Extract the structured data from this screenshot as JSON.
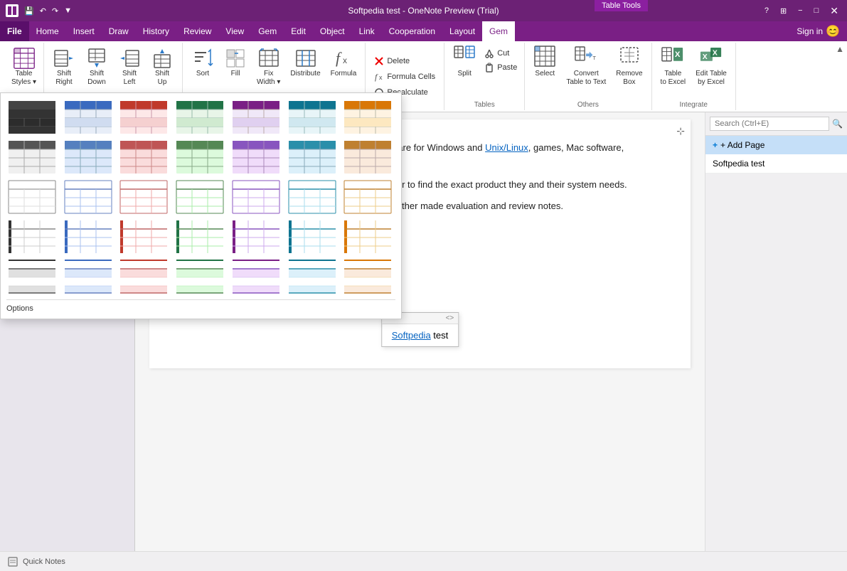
{
  "titleBar": {
    "appTitle": "Softpedia test - OneNote Preview (Trial)",
    "tableToolsLabel": "Table Tools",
    "buttons": [
      "minimize",
      "maximize",
      "close"
    ],
    "quickAccess": [
      "undo",
      "redo",
      "customize"
    ]
  },
  "menuBar": {
    "items": [
      "File",
      "Home",
      "Insert",
      "Draw",
      "History",
      "Review",
      "View",
      "Gem",
      "Edit",
      "Object",
      "Link",
      "Cooperation",
      "Layout",
      "Gem"
    ],
    "activeItem": "Gem",
    "signIn": "Sign in"
  },
  "ribbon": {
    "groups": [
      {
        "id": "table-styles",
        "label": "",
        "buttons": [
          {
            "id": "table-styles-btn",
            "label": "Table\nStyles -",
            "type": "large"
          }
        ]
      },
      {
        "id": "shift",
        "label": "",
        "buttons": [
          {
            "id": "shift-right",
            "label": "Shift\nRight",
            "type": "large"
          },
          {
            "id": "shift-down",
            "label": "Shift\nDown",
            "type": "large"
          },
          {
            "id": "shift-left",
            "label": "Shift\nLeft",
            "type": "large"
          },
          {
            "id": "shift-up",
            "label": "Shift\nUp",
            "type": "large"
          }
        ]
      },
      {
        "id": "sort-fill",
        "label": "",
        "buttons": [
          {
            "id": "sort",
            "label": "Sort",
            "type": "large"
          },
          {
            "id": "fill",
            "label": "Fill",
            "type": "large"
          },
          {
            "id": "fix-width",
            "label": "Fix\nWidth -",
            "type": "large"
          },
          {
            "id": "distribute",
            "label": "Distribute",
            "type": "large"
          },
          {
            "id": "formula",
            "label": "Formula",
            "type": "large"
          }
        ]
      },
      {
        "id": "edit-menu",
        "label": "",
        "buttons": [
          {
            "id": "delete",
            "label": "Delete",
            "type": "small"
          },
          {
            "id": "formula-cells",
            "label": "Formula Cells",
            "type": "small"
          },
          {
            "id": "recalculate",
            "label": "Recalculate",
            "type": "small"
          }
        ]
      },
      {
        "id": "tables",
        "label": "Tables",
        "buttons": [
          {
            "id": "split",
            "label": "Split",
            "type": "large"
          },
          {
            "id": "cut",
            "label": "Cut",
            "type": "small"
          },
          {
            "id": "paste",
            "label": "Paste",
            "type": "small"
          }
        ]
      },
      {
        "id": "others",
        "label": "Others",
        "buttons": [
          {
            "id": "select",
            "label": "Select",
            "type": "large"
          },
          {
            "id": "convert",
            "label": "Convert\nTable to Text",
            "type": "large"
          },
          {
            "id": "remove-box",
            "label": "Remove\nBox",
            "type": "large"
          }
        ]
      },
      {
        "id": "integrate",
        "label": "Integrate",
        "buttons": [
          {
            "id": "table-to-excel",
            "label": "Table\nto Excel",
            "type": "large"
          },
          {
            "id": "edit-table-by-excel",
            "label": "Edit Table\nby Excel",
            "type": "large"
          }
        ]
      }
    ]
  },
  "tableStyles": {
    "rows": 5,
    "cols": 7,
    "colors": [
      "black",
      "blue",
      "red",
      "green",
      "purple",
      "teal",
      "orange"
    ],
    "optionsLabel": "Options"
  },
  "content": {
    "paragraphs": [
      "is a library of over 1,500,000 free and free-to-try software for Windows and Unix/Linux, games, Mac software, Windows mobile devices and IT-related articles.",
      "w and categorize these products in order to allow the er to find the exact product they and their system needs.",
      "to deliver only the best products to the visitor/user together made evaluation and review notes.",
      "oftpedia test"
    ],
    "links": [
      "Unix/Linux",
      "Softpedia"
    ]
  },
  "floatTable": {
    "text": "Softpedia test",
    "toolbarDots": "····",
    "toolbarArrows": "<>"
  },
  "sidebar": {
    "searchPlaceholder": "Search (Ctrl+E)",
    "addPageLabel": "+ Add Page",
    "pages": [
      "Softpedia test"
    ]
  },
  "bottomBar": {
    "label": "Quick Notes"
  },
  "colors": {
    "titleBarBg": "#6c2175",
    "menuBarBg": "#7a1f85",
    "activeMenuBg": "#8b1fa0",
    "gemActive": "#8b1fa0",
    "ribbonBg": "#ffffff",
    "sidebarBg": "#f0eff1",
    "addPageBg": "#c5dff8",
    "accentBlue": "#0078d4"
  }
}
